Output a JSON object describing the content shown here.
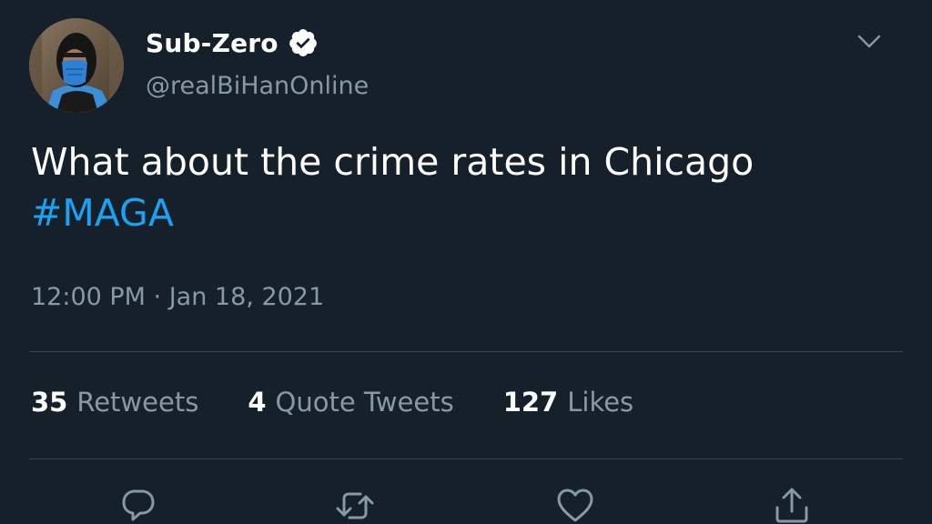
{
  "user": {
    "display_name": "Sub-Zero",
    "handle": "@realBiHanOnline",
    "verified": true
  },
  "tweet": {
    "text": "What about the crime rates in Chicago",
    "hashtag": "#MAGA",
    "timestamp": "12:00 PM · Jan 18, 2021"
  },
  "stats": {
    "retweets_count": "35",
    "retweets_label": "Retweets",
    "quotes_count": "4",
    "quotes_label": "Quote Tweets",
    "likes_count": "127",
    "likes_label": "Likes"
  },
  "actions": {
    "reply_icon": "reply-icon",
    "retweet_icon": "retweet-icon",
    "like_icon": "like-icon",
    "share_icon": "share-icon"
  },
  "colors": {
    "background": "#15202b",
    "primary_text": "#ffffff",
    "secondary_text": "#8899a6",
    "accent": "#1da1f2",
    "divider": "#38444d"
  }
}
